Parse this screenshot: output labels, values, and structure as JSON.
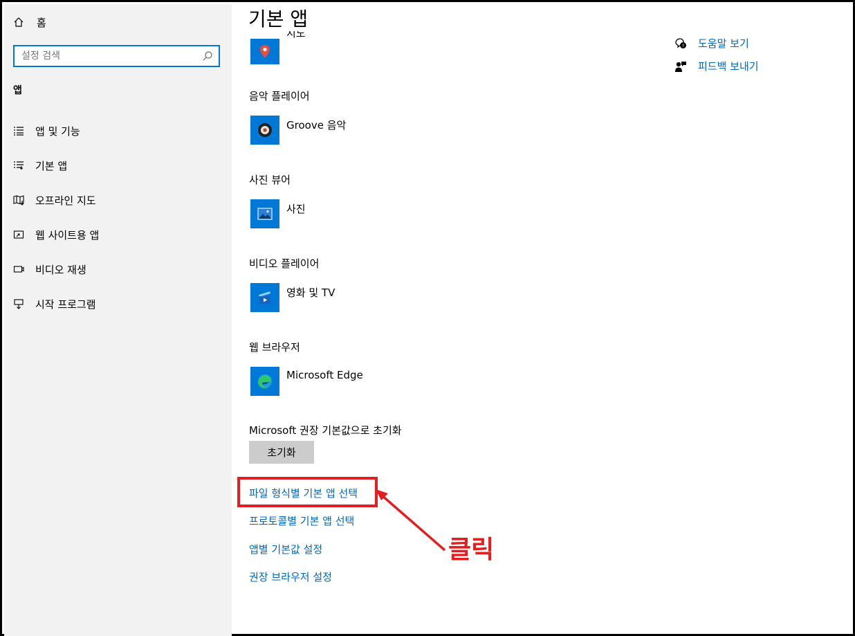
{
  "sidebar": {
    "home_label": "홈",
    "search_placeholder": "설정 검색",
    "section_label": "앱",
    "items": [
      {
        "label": "앱 및 기능",
        "icon": "list-icon"
      },
      {
        "label": "기본 앱",
        "icon": "default-apps-icon"
      },
      {
        "label": "오프라인 지도",
        "icon": "offline-map-icon"
      },
      {
        "label": "웹 사이트용 앱",
        "icon": "web-app-icon"
      },
      {
        "label": "비디오 재생",
        "icon": "video-playback-icon"
      },
      {
        "label": "시작 프로그램",
        "icon": "startup-icon"
      }
    ]
  },
  "main": {
    "title": "기본 앱",
    "partial_app_name": "지도",
    "categories": [
      {
        "heading": "음악 플레이어",
        "app": "Groove 음악",
        "icon": "groove-music-icon"
      },
      {
        "heading": "사진 뷰어",
        "app": "사진",
        "icon": "photos-icon"
      },
      {
        "heading": "비디오 플레이어",
        "app": "영화 및 TV",
        "icon": "movies-tv-icon"
      },
      {
        "heading": "웹 브라우저",
        "app": "Microsoft Edge",
        "icon": "edge-icon"
      }
    ],
    "reset_label": "Microsoft 권장 기본값으로 초기화",
    "reset_button": "초기화",
    "links": [
      "파일 형식별 기본 앱 선택",
      "프로토콜별 기본 앱 선택",
      "앱별 기본값 설정",
      "권장 브라우저 설정"
    ]
  },
  "right_links": {
    "help": "도움말 보기",
    "feedback": "피드백 보내기"
  },
  "annotation": {
    "label": "클릭",
    "color": "#e41e1e"
  },
  "colors": {
    "accent": "#0078d7",
    "link": "#0067c0",
    "sidebar_bg": "#f2f2f2"
  }
}
